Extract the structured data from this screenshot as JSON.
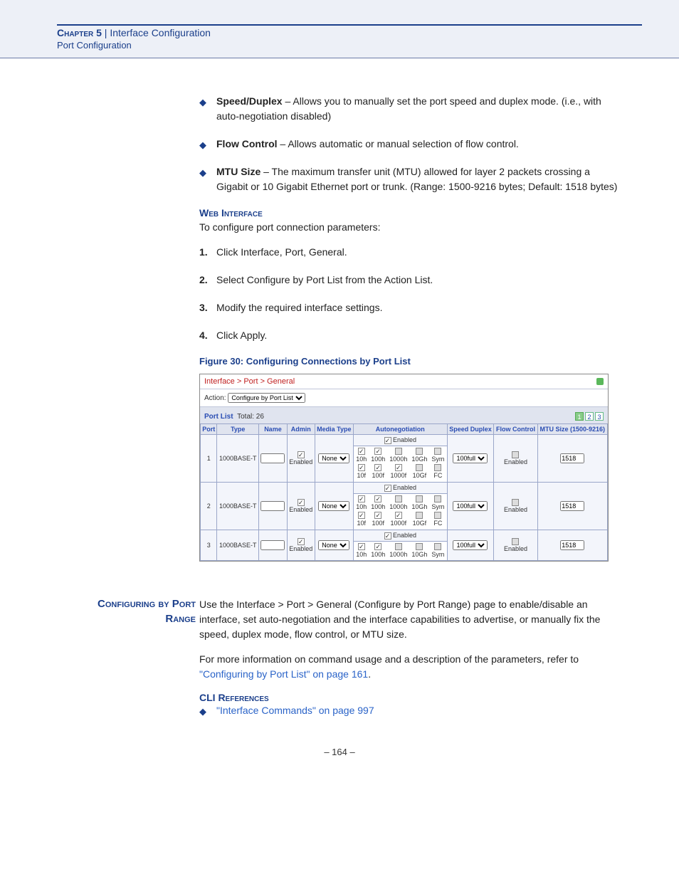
{
  "header": {
    "chapter": "Chapter 5",
    "sep": "  |  ",
    "title": "Interface Configuration",
    "subtitle": "Port Configuration"
  },
  "bullets": {
    "speed": {
      "label": "Speed/Duplex",
      "text": " – Allows you to manually set the port speed and duplex mode. (i.e., with auto-negotiation disabled)"
    },
    "flow": {
      "label": "Flow Control",
      "text": " – Allows automatic or manual selection of flow control."
    },
    "mtu": {
      "label": "MTU Size",
      "text": " – The maximum transfer unit (MTU) allowed for layer 2 packets crossing a Gigabit or 10 Gigabit Ethernet port or trunk. (Range: 1500-9216 bytes; Default: 1518 bytes)"
    }
  },
  "web": {
    "heading": "Web Interface",
    "intro": "To configure port connection parameters:",
    "steps": [
      "Click Interface, Port, General.",
      "Select Configure by Port List from the Action List.",
      "Modify the required interface settings.",
      "Click Apply."
    ]
  },
  "figure": {
    "caption": "Figure 30:  Configuring Connections by Port List"
  },
  "shot": {
    "breadcrumb": "Interface > Port > General",
    "action_label": "Action:",
    "action_value": "Configure by Port List",
    "list_label": "Port List",
    "total_label": "Total: 26",
    "pages": [
      "1",
      "2",
      "3"
    ],
    "headers": {
      "port": "Port",
      "type": "Type",
      "name": "Name",
      "admin": "Admin",
      "media": "Media Type",
      "autoneg": "Autonegotiation",
      "speed": "Speed Duplex",
      "flow": "Flow Control",
      "mtu": "MTU Size (1500-9216)"
    },
    "enabled_label": "Enabled",
    "speed_value": "100full",
    "mtu_value": "1518",
    "media_value": "None",
    "auto_cols": {
      "c1": [
        "10h",
        "10f"
      ],
      "c2": [
        "100h",
        "100f"
      ],
      "c3": [
        "1000h",
        "1000f"
      ],
      "c4": [
        "10Gh",
        "10Gf"
      ],
      "c5": [
        "Sym",
        "FC"
      ]
    },
    "rows": [
      {
        "port": "1",
        "type": "1000BASE-T"
      },
      {
        "port": "2",
        "type": "1000BASE-T"
      },
      {
        "port": "3",
        "type": "1000BASE-T"
      }
    ]
  },
  "range": {
    "heading": "Configuring by Port Range",
    "para1": "Use the Interface > Port > General (Configure by Port Range) page to enable/disable an interface, set auto-negotiation and the interface capabilities to advertise, or manually fix the speed, duplex mode, flow control, or MTU size.",
    "para2a": "For more information on command usage and a description of the parameters, refer to ",
    "para2link": "\"Configuring by Port List\" on page 161",
    "para2b": "."
  },
  "cli": {
    "heading": "CLI References",
    "link": "\"Interface Commands\" on page 997"
  },
  "footer": {
    "page": "–  164  –"
  }
}
